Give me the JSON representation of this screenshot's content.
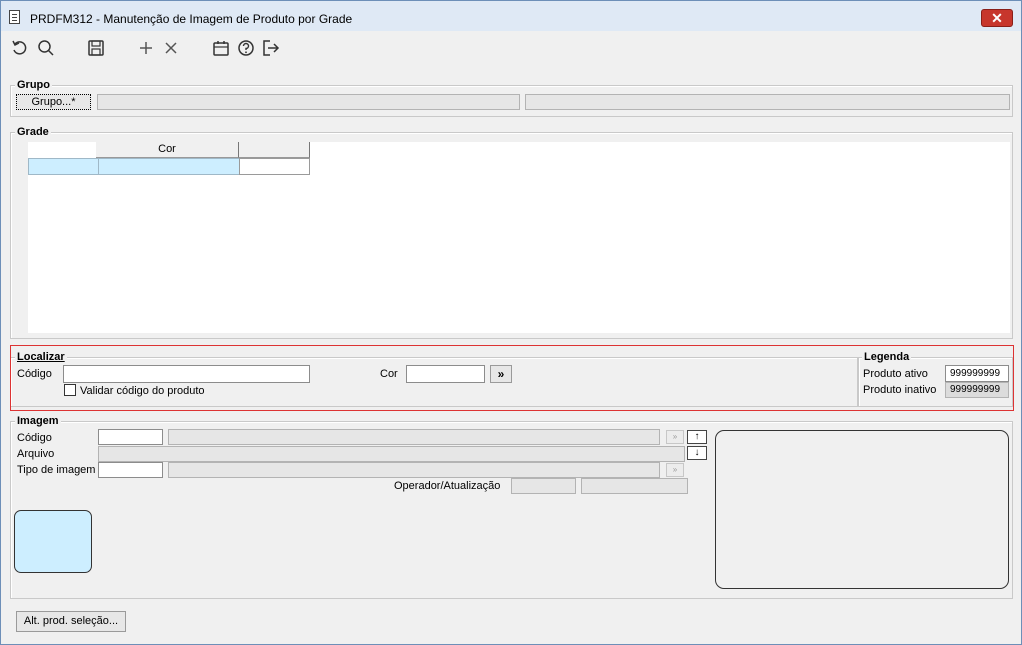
{
  "window": {
    "title": "PRDFM312 - Manutenção de Imagem de Produto por Grade",
    "close_label": "✕"
  },
  "toolbar": {
    "icons": [
      "undo-icon",
      "search-icon",
      "save-icon",
      "add-icon",
      "delete-icon",
      "calendar-icon",
      "help-icon",
      "exit-icon"
    ]
  },
  "grupo": {
    "section_label": "Grupo",
    "button_label": "Grupo...*",
    "field1_value": "",
    "field2_value": ""
  },
  "grade": {
    "section_label": "Grade",
    "columns": [
      "",
      "Cor",
      ""
    ],
    "rows": [
      [
        "",
        "",
        ""
      ]
    ]
  },
  "localizar": {
    "section_label": "Localizar",
    "codigo_label": "Código",
    "codigo_value": "",
    "cor_label": "Cor",
    "cor_value": "",
    "go_button_label": "»",
    "validar_label": "Validar código do produto",
    "validar_checked": false
  },
  "legenda": {
    "section_label": "Legenda",
    "ativo_label": "Produto ativo",
    "ativo_value": "999999999",
    "inativo_label": "Produto inativo",
    "inativo_value": "999999999"
  },
  "imagem": {
    "section_label": "Imagem",
    "codigo_label": "Código",
    "codigo_value": "",
    "codigo_desc": "",
    "arquivo_label": "Arquivo",
    "arquivo_value": "",
    "tipo_label": "Tipo de imagem",
    "tipo_value": "",
    "tipo_desc": "",
    "operador_label": "Operador/Atualização",
    "operador_value": "",
    "atualizacao_value": ""
  },
  "footer": {
    "alt_button_label": "Alt. prod. seleção..."
  },
  "colors": {
    "selection": "#cdeeff",
    "highlight_border": "#dd3333",
    "close_button": "#c7362c"
  }
}
